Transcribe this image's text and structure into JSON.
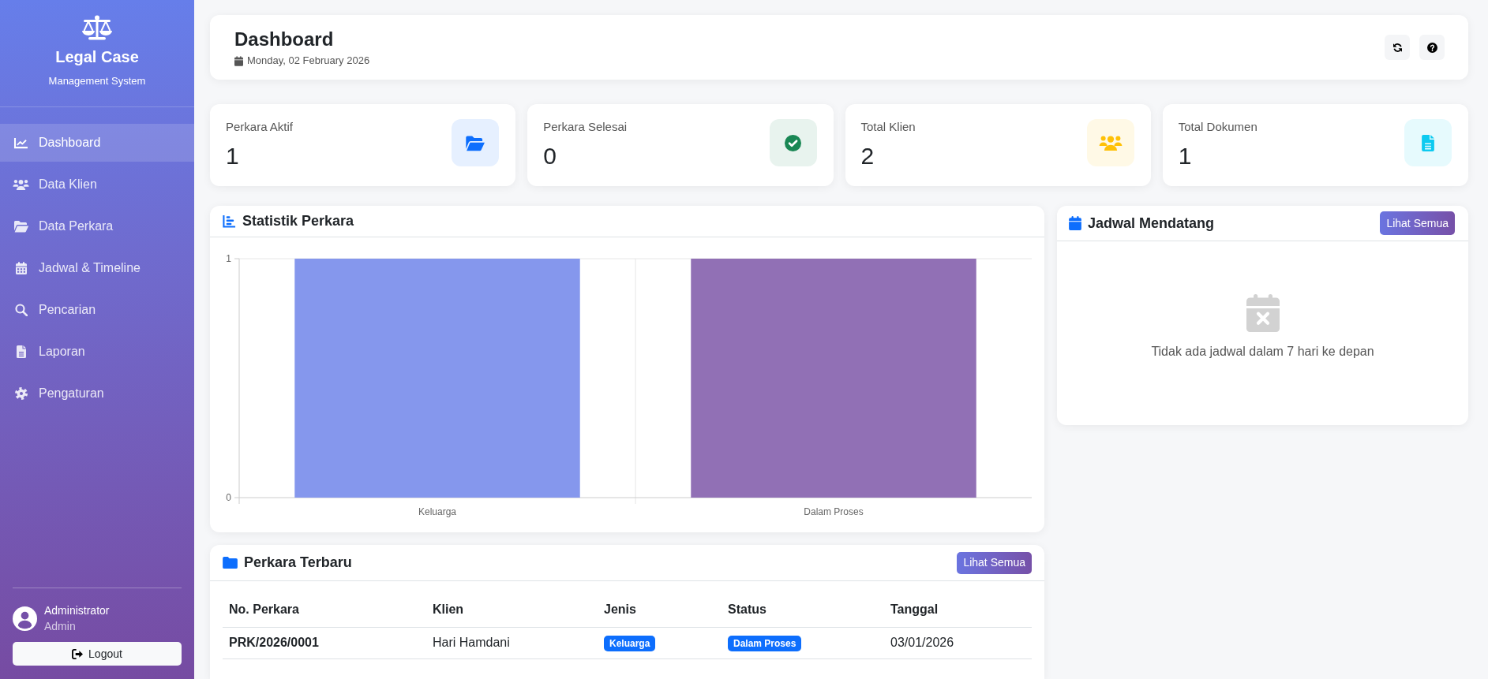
{
  "sidebar": {
    "brand": {
      "title": "Legal Case",
      "subtitle": "Management System"
    },
    "items": [
      {
        "label": "Dashboard",
        "selected": true
      },
      {
        "label": "Data Klien",
        "selected": false
      },
      {
        "label": "Data Perkara",
        "selected": false
      },
      {
        "label": "Jadwal & Timeline",
        "selected": false
      },
      {
        "label": "Pencarian",
        "selected": false
      },
      {
        "label": "Laporan",
        "selected": false
      },
      {
        "label": "Pengaturan",
        "selected": false
      }
    ],
    "user": {
      "name": "Administrator",
      "role": "Admin"
    },
    "logout_button": "Logout"
  },
  "header": {
    "title": "Dashboard",
    "date": "Monday, 02 February 2026"
  },
  "stats": [
    {
      "label": "Perkara Aktif",
      "value": "1",
      "color": "#0d6efd"
    },
    {
      "label": "Perkara Selesai",
      "value": "0",
      "color": "#198754"
    },
    {
      "label": "Total Klien",
      "value": "2",
      "color": "#ffc107"
    },
    {
      "label": "Total Dokumen",
      "value": "1",
      "color": "#0dcaf0"
    }
  ],
  "chart_panel": {
    "title": "Statistik Perkara",
    "chart_data": {
      "type": "bar",
      "categories": [
        "Keluarga",
        "Dalam Proses"
      ],
      "series": [
        {
          "values": [
            1,
            1
          ]
        }
      ],
      "ylim": [
        0,
        1
      ],
      "yticks": [
        0,
        1
      ]
    }
  },
  "schedule_panel": {
    "title": "Jadwal Mendatang",
    "button": "Lihat Semua",
    "empty_message": "Tidak ada jadwal dalam 7 hari ke depan"
  },
  "recent_cases": {
    "title": "Perkara Terbaru",
    "button": "Lihat Semua",
    "table": {
      "columns": [
        "No. Perkara",
        "Klien",
        "Jenis",
        "Status",
        "Tanggal"
      ],
      "rows": [
        {
          "case_number": "PRK/2026/0001",
          "client": "Hari Hamdani",
          "type": "Keluarga",
          "status": "Dalam Proses",
          "date": "03/01/2026"
        }
      ]
    }
  }
}
